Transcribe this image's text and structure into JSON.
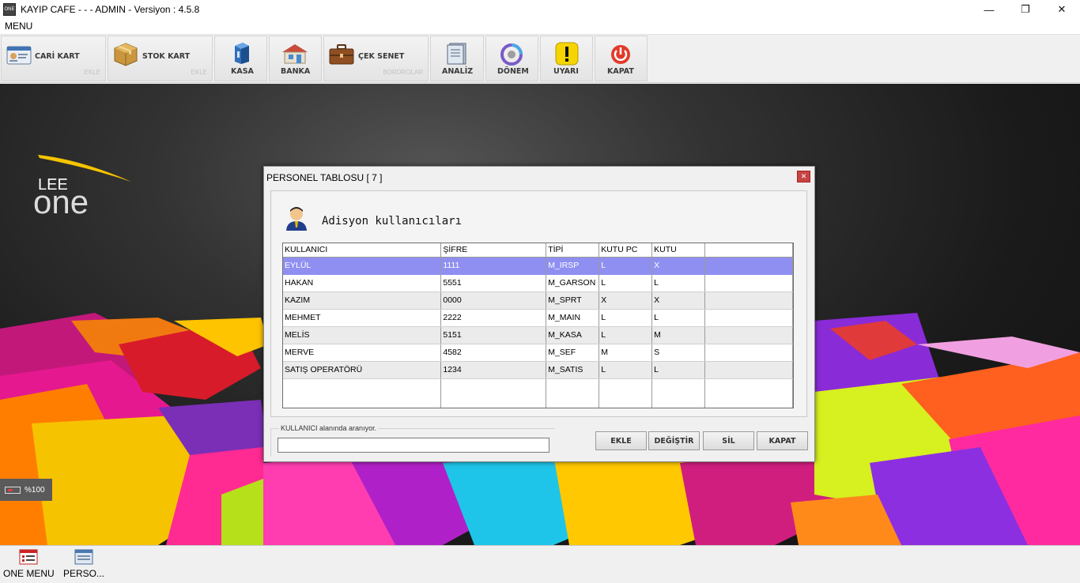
{
  "window": {
    "title": "KAYIP CAFE -  -  - ADMIN -  Versiyon : 4.5.8",
    "app_icon_text": "ONE"
  },
  "menu": {
    "label": "MENU"
  },
  "toolbar": {
    "buttons": [
      {
        "label": "CARİ KART",
        "sub": "EKLE",
        "icon": "id-card-icon"
      },
      {
        "label": "STOK KART",
        "sub": "EKLE",
        "icon": "box-icon"
      },
      {
        "label": "KASA",
        "icon": "cash-register-icon"
      },
      {
        "label": "BANKA",
        "icon": "bank-icon"
      },
      {
        "label": "ÇEK SENET",
        "sub": "BORDROLAR",
        "icon": "briefcase-icon"
      },
      {
        "label": "ANALİZ",
        "icon": "book-icon"
      },
      {
        "label": "DÖNEM",
        "icon": "period-ring-icon"
      },
      {
        "label": "UYARI",
        "icon": "warning-icon"
      },
      {
        "label": "KAPAT",
        "icon": "power-icon"
      }
    ]
  },
  "logo": {
    "line1": "LEE",
    "line2": "one"
  },
  "battery": {
    "text": "%100"
  },
  "taskbar": {
    "items": [
      {
        "label": "ONE MENU",
        "icon": "menu-window-icon"
      },
      {
        "label": "PERSO...",
        "icon": "staff-window-icon"
      }
    ]
  },
  "dialog": {
    "title": "PERSONEL TABLOSU [ 7 ]",
    "heading": "Adisyon kullanıcıları",
    "columns": [
      "KULLANICI",
      "ŞİFRE",
      "TİPİ",
      "KUTU PC",
      "KUTU"
    ],
    "rows": [
      [
        "EYLÜL",
        "1111",
        "M_IRSP",
        "L",
        "X"
      ],
      [
        "HAKAN",
        "5551",
        "M_GARSON",
        "L",
        "L"
      ],
      [
        "KAZIM",
        "0000",
        "M_SPRT",
        "X",
        "X"
      ],
      [
        "MEHMET",
        "2222",
        "M_MAIN",
        "L",
        "L"
      ],
      [
        "MELİS",
        "5151",
        "M_KASA",
        "L",
        "M"
      ],
      [
        "MERVE",
        "4582",
        "M_SEF",
        "M",
        "S"
      ],
      [
        "SATIŞ OPERATÖRÜ",
        "1234",
        "M_SATIS",
        "L",
        "L"
      ]
    ],
    "selected_row": 0,
    "search": {
      "label": "KULLANICI alanında aranıyor.",
      "value": ""
    },
    "buttons": {
      "add": "EKLE",
      "change": "DEĞİŞTİR",
      "delete": "SİL",
      "close": "KAPAT"
    }
  },
  "colors": {
    "selection": "#8f8ff2",
    "accent_yellow": "#f5c400",
    "close_red": "#c74444"
  }
}
